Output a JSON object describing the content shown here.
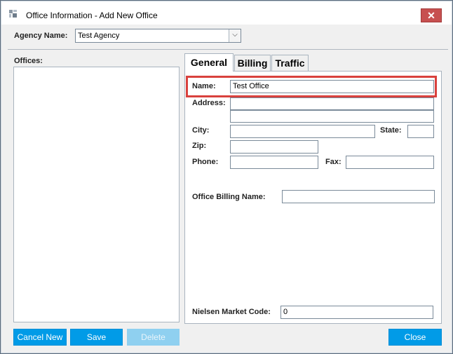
{
  "window": {
    "title": "Office Information - Add New Office",
    "close_glyph": "✕"
  },
  "agency": {
    "label": "Agency Name:",
    "value": "Test Agency",
    "dropdown_glyph": "⌵"
  },
  "offices": {
    "label": "Offices:"
  },
  "tabs": [
    {
      "label": "General"
    },
    {
      "label": "Billing"
    },
    {
      "label": "Traffic"
    }
  ],
  "general": {
    "name_label": "Name:",
    "name_value": "Test Office",
    "address_label": "Address:",
    "address_line1": "",
    "address_line2": "",
    "city_label": "City:",
    "city_value": "",
    "state_label": "State:",
    "state_value": "",
    "zip_label": "Zip:",
    "zip_value": "",
    "phone_label": "Phone:",
    "phone_value": "",
    "fax_label": "Fax:",
    "fax_value": "",
    "billing_name_label": "Office Billing Name:",
    "billing_name_value": "",
    "nielsen_label": "Nielsen Market Code:",
    "nielsen_value": "0"
  },
  "buttons": {
    "cancel_new": "Cancel New",
    "save": "Save",
    "delete": "Delete",
    "close": "Close"
  },
  "colors": {
    "accent": "#019be7",
    "highlight": "#d9413d"
  }
}
